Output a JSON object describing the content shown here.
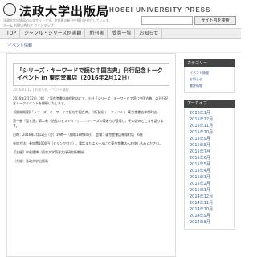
{
  "header": {
    "logo_jp": "法政大学出版局",
    "logo_en": "HOSEI UNIVERSITY PRESS",
    "tagline": "法政大学出版局の公式サイトです。学術書の新刊や既刊を紹介しています。",
    "mini_nav": "ホーム  お問い合わせ  サイトマップ",
    "search_placeholder": "",
    "search_button": "サイト内を検索"
  },
  "menu": [
    "TOP",
    "ジャンル・シリーズ別書籍",
    "新刊書",
    "受賞一覧",
    "お知らせ"
  ],
  "breadcrumb": "イベント情報",
  "article": {
    "title": "「シリーズ・キーワードで読む中国古典」刊行記念トークイベント in 東京堂書店（2016年2月12日）",
    "date": "2016-01-12  |  お知らせ, イベント情報",
    "paragraphs": [
      "2016年2月12日（金）に東京堂書店神保町店にて、小社「シリーズ・キーワードで読む中国古典」の刊行記念トークイベントを開催いたします。",
      "【開催概要】「シリーズ・キーワードで読む中国古典」刊行記念トークイベント 東京堂書店神保町店。",
      "第一巻『聖と狂』第二巻『治乱のヒストリア』……シリーズの著者らが登壇し、その読みどころを語ります。",
      "日時：2016年2月12日（金）19時～（開場18時30分）　会場：東京堂書店神保町店　6階",
      "参加方法：参加費1000円（ドリンク付き）。電話またはメールにて東京堂書店へお申し込みください。",
      "【主催】中島隆博（東京大学東洋文化研究所教授）",
      "（共催）法政大学出版局"
    ]
  },
  "sidebar": {
    "category_title": "カテゴリー",
    "categories": [
      "イベント情報",
      "お知らせ",
      "書評情報"
    ],
    "archive_title": "アーカイブ",
    "archives": [
      "2016年1月",
      "2015年12月",
      "2015年11月",
      "2015年10月",
      "2015年9月",
      "2015年8月",
      "2015年7月",
      "2015年6月",
      "2015年5月",
      "2015年4月",
      "2015年3月",
      "2015年2月",
      "2015年1月",
      "2014年12月",
      "2014年11月",
      "2014年10月",
      "2014年9月",
      "2014年8月"
    ]
  }
}
